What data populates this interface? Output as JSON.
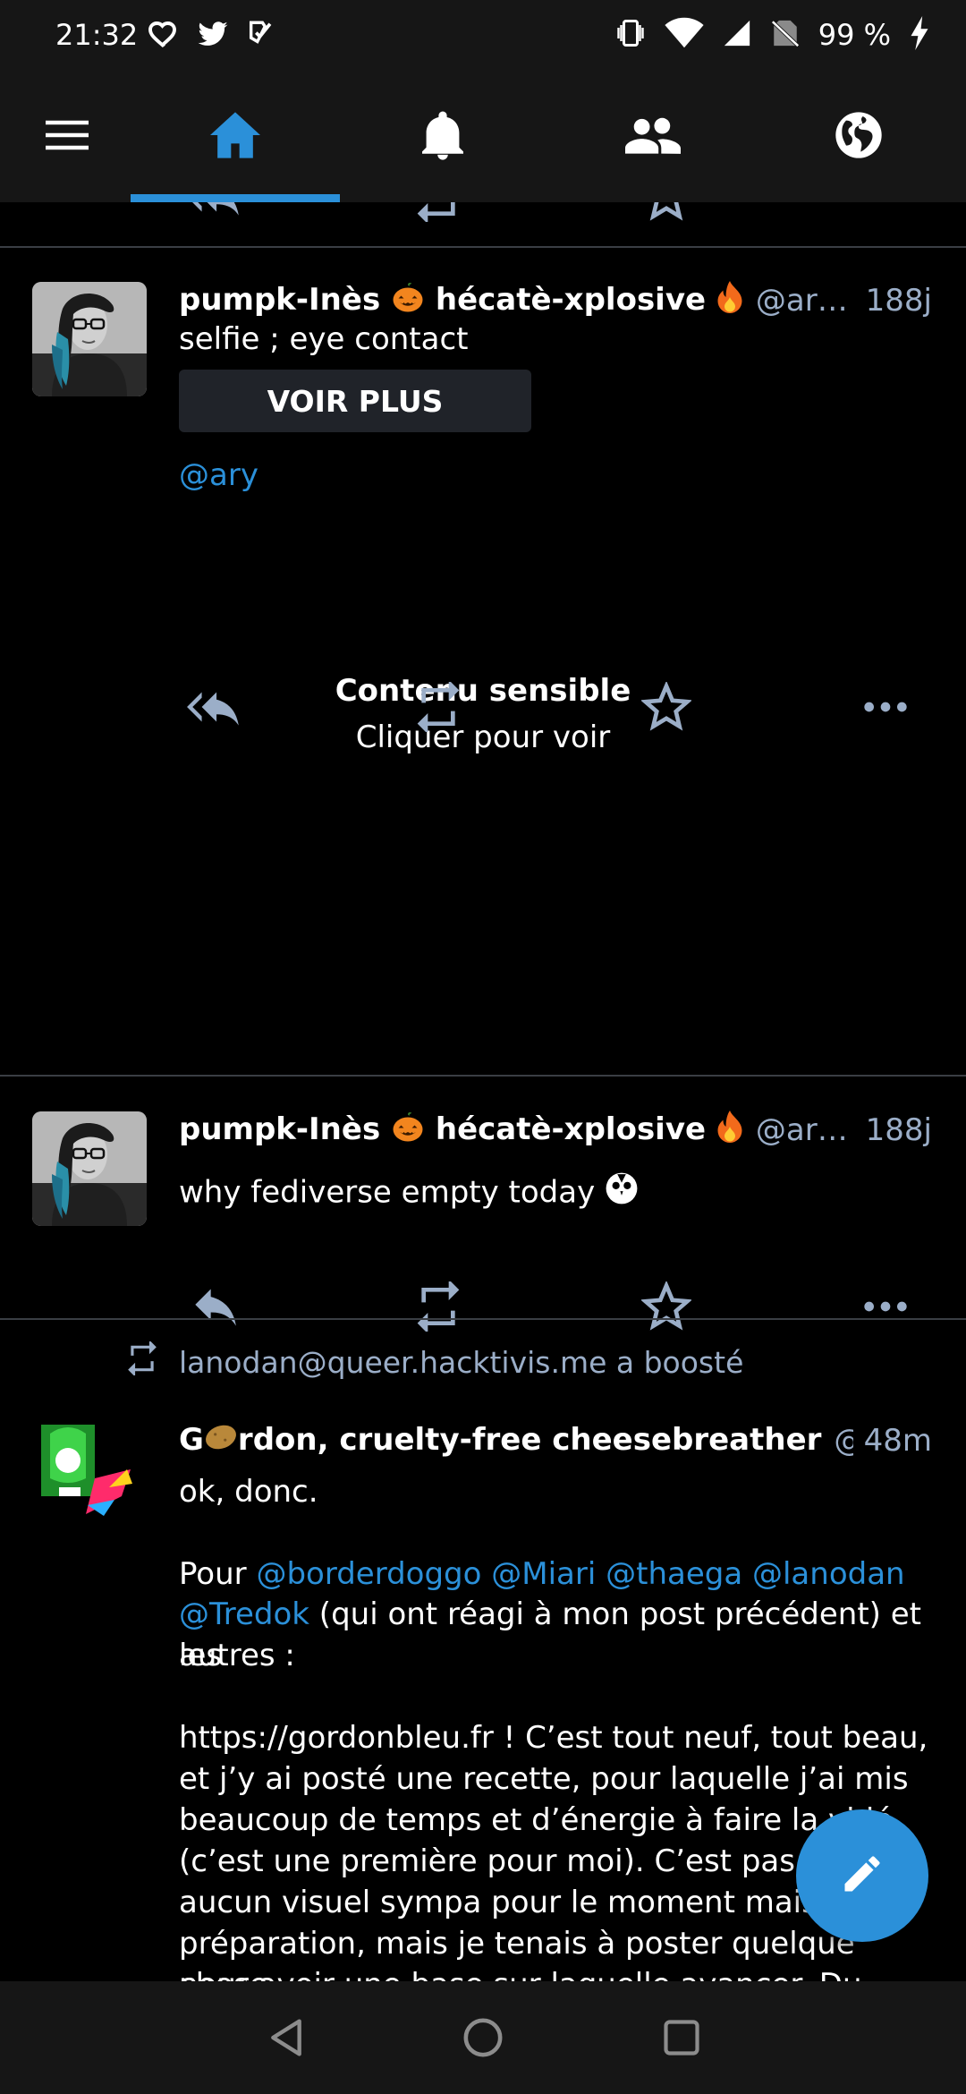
{
  "status_bar": {
    "time": "21:32",
    "left_icons": [
      "heart-icon",
      "twitter-icon",
      "check-icon"
    ],
    "right_icons": [
      "vibrate-icon",
      "wifi-icon",
      "signal-icon",
      "no-sim-icon"
    ],
    "battery": "99 %",
    "battery_icon": "charging-icon"
  },
  "nav": {
    "items": [
      {
        "icon": "menu-icon"
      },
      {
        "icon": "home-icon",
        "active": true
      },
      {
        "icon": "bell-icon"
      },
      {
        "icon": "people-icon"
      },
      {
        "icon": "globe-icon"
      }
    ],
    "active_color": "#2b90d9"
  },
  "posts": [
    {
      "name": "pumpk-Inès",
      "name_suffix": "hécatè-xplosive",
      "acct": "@ary@s...",
      "time": "188j",
      "spoiler_text": "selfie ; eye contact",
      "more_button": "VOIR PLUS",
      "mention": "@ary",
      "sensitive_title": "Contenu sensible",
      "sensitive_sub": "Cliquer pour voir"
    },
    {
      "name": "pumpk-Inès",
      "name_suffix": "hécatè-xplosive",
      "acct": "@ary@s...",
      "time": "188j",
      "text": "why fediverse empty today"
    },
    {
      "boost_by": "lanodan@queer.hacktivis.me a boosté",
      "name_prefix": "G",
      "name_rest": "rdon, cruelty-free cheesebreather",
      "acct": "@go...",
      "time": "48m",
      "line1": "ok, donc.",
      "pour": "Pour ",
      "mentions_row1": [
        "@borderdoggo",
        "@Miari",
        "@thaega",
        "@lanodan"
      ],
      "mention_row2": "@Tredok",
      "after_mentions": " (qui ont réagi à mon post précédent) et les",
      "line_autres": "autres :",
      "body_lines": [
        "https://gordonbleu.fr ! C’est tout neuf, tout beau,",
        "et j’y ai posté une recette, pour laquelle j’ai mis",
        "beaucoup de temps et d’énergie à faire la vidé",
        "(c’est une première pour moi). C’est pas fini",
        "aucun visuel sympa pour le moment mais c’e",
        "préparation, mais je tenais à poster quelque chose",
        "pour avoir une base sur laquelle avancer. Du coup, je"
      ]
    }
  ],
  "fab_icon": "pencil-icon",
  "system_nav": [
    "back-icon",
    "home-circle-icon",
    "recents-icon"
  ]
}
